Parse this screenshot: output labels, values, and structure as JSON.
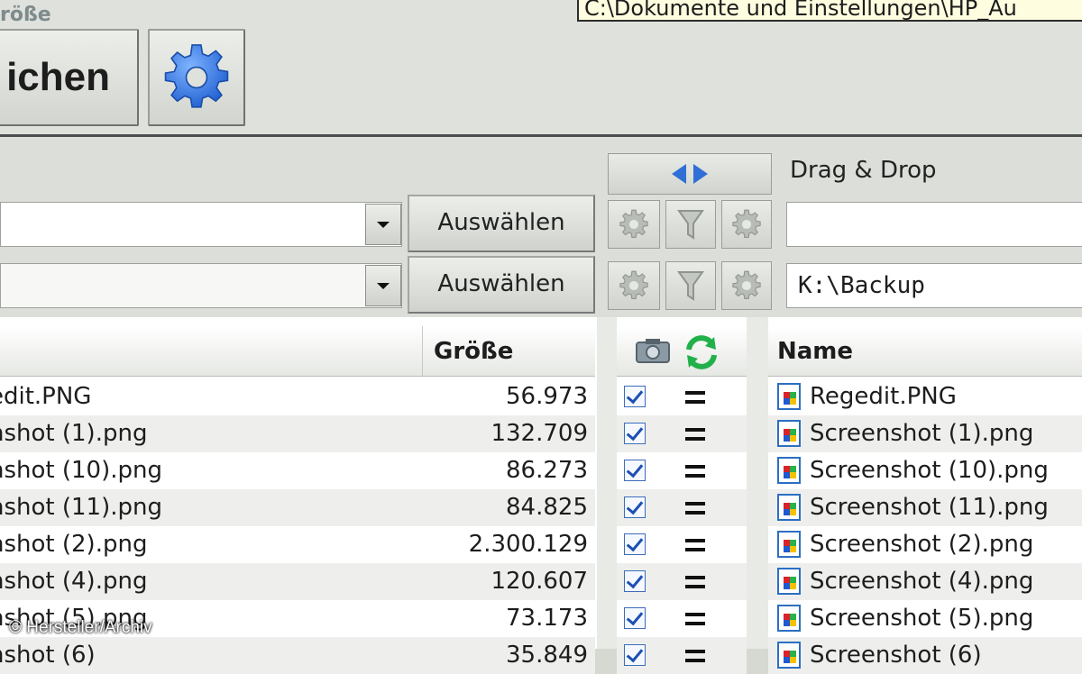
{
  "top": {
    "label": "röße",
    "path_tooltip": "C:\\Dokumente und Einstellungen\\HP_Au",
    "compare_button": "ichen"
  },
  "controls": {
    "drag_drop_label": "Drag & Drop",
    "select_label_1": "Auswählen",
    "select_label_2": "Auswählen",
    "target_path_1": "",
    "target_path_2": "K:\\Backup"
  },
  "left_list": {
    "header_size": "Größe",
    "rows": [
      {
        "name": "edit.PNG",
        "size": "56.973"
      },
      {
        "name": "nshot (1).png",
        "size": "132.709"
      },
      {
        "name": "nshot (10).png",
        "size": "86.273"
      },
      {
        "name": "nshot (11).png",
        "size": "84.825"
      },
      {
        "name": "nshot (2).png",
        "size": "2.300.129"
      },
      {
        "name": "nshot (4).png",
        "size": "120.607"
      },
      {
        "name": "nshot (5).png",
        "size": "73.173"
      },
      {
        "name": "nshot (6)",
        "size": "35.849"
      }
    ]
  },
  "right_list": {
    "header_name": "Name",
    "rows": [
      {
        "name": "Regedit.PNG"
      },
      {
        "name": "Screenshot (1).png"
      },
      {
        "name": "Screenshot (10).png"
      },
      {
        "name": "Screenshot (11).png"
      },
      {
        "name": "Screenshot (2).png"
      },
      {
        "name": "Screenshot (4).png"
      },
      {
        "name": "Screenshot (5).png"
      },
      {
        "name": "Screenshot (6)"
      }
    ]
  },
  "copyright": "© Hersteller/Archiv",
  "colors": {
    "accent_blue": "#2f6fd6",
    "refresh_green": "#22b04a"
  }
}
